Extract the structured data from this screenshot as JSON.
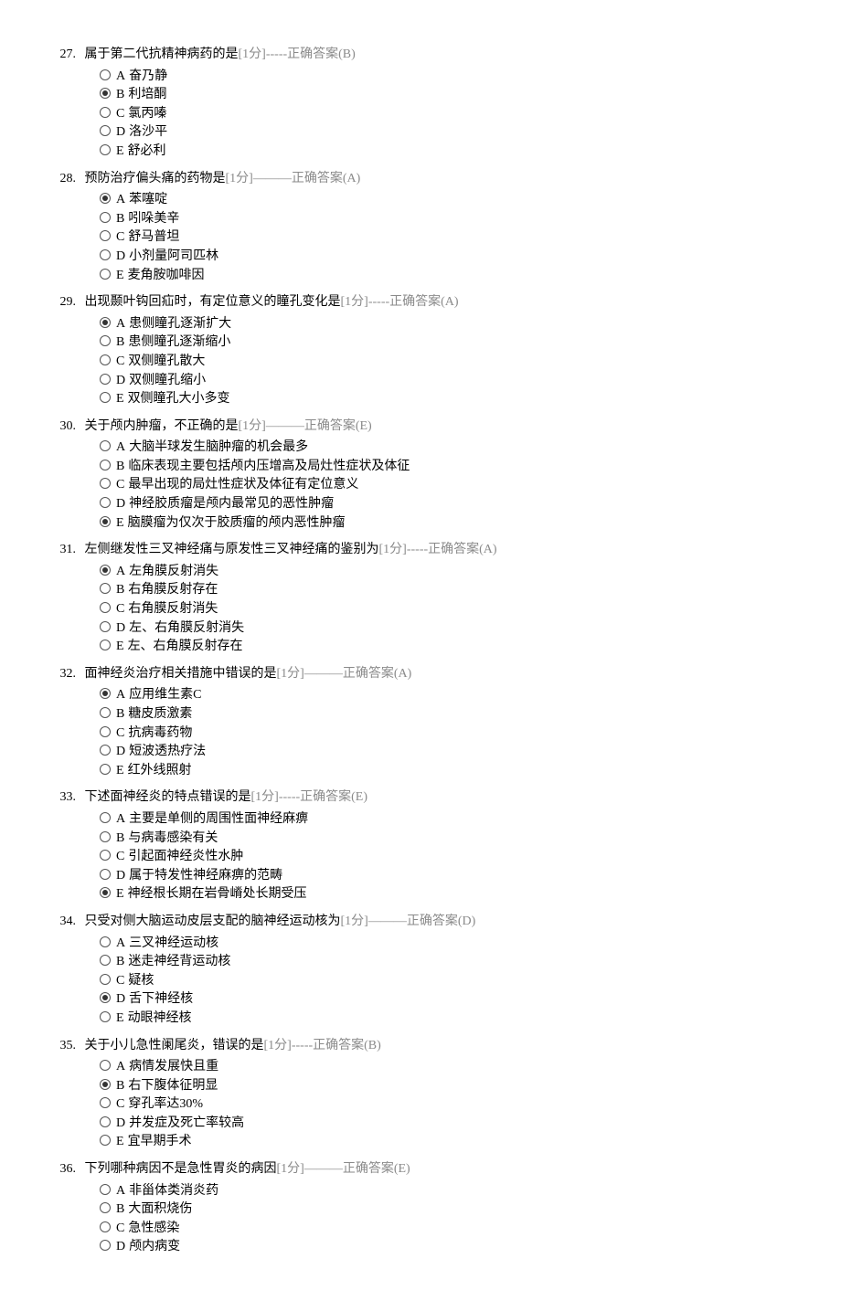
{
  "score_label": "[1分]",
  "answer_prefix": "正确答案",
  "questions": [
    {
      "number": "27",
      "stem": "属于第二代抗精神病药的是",
      "dashes": "-----",
      "answer": "(B)",
      "options": [
        {
          "label": "A",
          "text": "奋乃静",
          "selected": false
        },
        {
          "label": "B",
          "text": "利培酮",
          "selected": true
        },
        {
          "label": "C",
          "text": "氯丙嗪",
          "selected": false
        },
        {
          "label": "D",
          "text": "洛沙平",
          "selected": false
        },
        {
          "label": "E",
          "text": "舒必利",
          "selected": false
        }
      ]
    },
    {
      "number": "28",
      "stem": "预防治疗偏头痛的药物是",
      "dashes": "———",
      "answer": "(A)",
      "options": [
        {
          "label": "A",
          "text": "苯噻啶",
          "selected": true
        },
        {
          "label": "B",
          "text": "吲哚美辛",
          "selected": false
        },
        {
          "label": "C",
          "text": "舒马普坦",
          "selected": false
        },
        {
          "label": "D",
          "text": "小剂量阿司匹林",
          "selected": false
        },
        {
          "label": "E",
          "text": "麦角胺咖啡因",
          "selected": false
        }
      ]
    },
    {
      "number": "29",
      "stem": "出现颞叶钩回疝时，有定位意义的瞳孔变化是",
      "dashes": "-----",
      "answer": "(A)",
      "options": [
        {
          "label": "A",
          "text": "患侧瞳孔逐渐扩大",
          "selected": true
        },
        {
          "label": "B",
          "text": "患侧瞳孔逐渐缩小",
          "selected": false
        },
        {
          "label": "C",
          "text": "双侧瞳孔散大",
          "selected": false
        },
        {
          "label": "D",
          "text": "双侧瞳孔缩小",
          "selected": false
        },
        {
          "label": "E",
          "text": "双侧瞳孔大小多变",
          "selected": false
        }
      ]
    },
    {
      "number": "30",
      "stem": "关于颅内肿瘤，不正确的是",
      "dashes": "———",
      "answer": "(E)",
      "options": [
        {
          "label": "A",
          "text": "大脑半球发生脑肿瘤的机会最多",
          "selected": false
        },
        {
          "label": "B",
          "text": "临床表现主要包括颅内压增高及局灶性症状及体征",
          "selected": false
        },
        {
          "label": "C",
          "text": "最早出现的局灶性症状及体征有定位意义",
          "selected": false
        },
        {
          "label": "D",
          "text": "神经胶质瘤是颅内最常见的恶性肿瘤",
          "selected": false
        },
        {
          "label": "E",
          "text": "脑膜瘤为仅次于胶质瘤的颅内恶性肿瘤",
          "selected": true
        }
      ]
    },
    {
      "number": "31",
      "stem": "左侧继发性三叉神经痛与原发性三叉神经痛的鉴别为",
      "dashes": "-----",
      "answer": "(A)",
      "options": [
        {
          "label": "A",
          "text": "左角膜反射消失",
          "selected": true
        },
        {
          "label": "B",
          "text": "右角膜反射存在",
          "selected": false
        },
        {
          "label": "C",
          "text": "右角膜反射消失",
          "selected": false
        },
        {
          "label": "D",
          "text": "左、右角膜反射消失",
          "selected": false
        },
        {
          "label": "E",
          "text": "左、右角膜反射存在",
          "selected": false
        }
      ]
    },
    {
      "number": "32",
      "stem": "面神经炎治疗相关措施中错误的是",
      "dashes": "———",
      "answer": "(A)",
      "options": [
        {
          "label": "A",
          "text": "应用维生素C",
          "selected": true
        },
        {
          "label": "B",
          "text": "糖皮质激素",
          "selected": false
        },
        {
          "label": "C",
          "text": "抗病毒药物",
          "selected": false
        },
        {
          "label": "D",
          "text": "短波透热疗法",
          "selected": false
        },
        {
          "label": "E",
          "text": "红外线照射",
          "selected": false
        }
      ]
    },
    {
      "number": "33",
      "stem": "下述面神经炎的特点错误的是",
      "dashes": "-----",
      "answer": "(E)",
      "options": [
        {
          "label": "A",
          "text": "主要是单侧的周围性面神经麻痹",
          "selected": false
        },
        {
          "label": "B",
          "text": "与病毒感染有关",
          "selected": false
        },
        {
          "label": "C",
          "text": "引起面神经炎性水肿",
          "selected": false
        },
        {
          "label": "D",
          "text": "属于特发性神经麻痹的范畴",
          "selected": false
        },
        {
          "label": "E",
          "text": "神经根长期在岩骨嵴处长期受压",
          "selected": true
        }
      ]
    },
    {
      "number": "34",
      "stem": "只受对侧大脑运动皮层支配的脑神经运动核为",
      "dashes": "———",
      "answer": "(D)",
      "options": [
        {
          "label": "A",
          "text": "三叉神经运动核",
          "selected": false
        },
        {
          "label": "B",
          "text": "迷走神经背运动核",
          "selected": false
        },
        {
          "label": "C",
          "text": "疑核",
          "selected": false
        },
        {
          "label": "D",
          "text": "舌下神经核",
          "selected": true
        },
        {
          "label": "E",
          "text": "动眼神经核",
          "selected": false
        }
      ]
    },
    {
      "number": "35",
      "stem": "关于小儿急性阑尾炎，错误的是",
      "dashes": "-----",
      "answer": "(B)",
      "options": [
        {
          "label": "A",
          "text": "病情发展快且重",
          "selected": false
        },
        {
          "label": "B",
          "text": "右下腹体征明显",
          "selected": true
        },
        {
          "label": "C",
          "text": "穿孔率达30%",
          "selected": false
        },
        {
          "label": "D",
          "text": "并发症及死亡率较高",
          "selected": false
        },
        {
          "label": "E",
          "text": "宜早期手术",
          "selected": false
        }
      ]
    },
    {
      "number": "36",
      "stem": "下列哪种病因不是急性胃炎的病因",
      "dashes": "———",
      "answer": "(E)",
      "options": [
        {
          "label": "A",
          "text": "非甾体类消炎药",
          "selected": false
        },
        {
          "label": "B",
          "text": "大面积烧伤",
          "selected": false
        },
        {
          "label": "C",
          "text": "急性感染",
          "selected": false
        },
        {
          "label": "D",
          "text": "颅内病变",
          "selected": false
        }
      ]
    }
  ]
}
